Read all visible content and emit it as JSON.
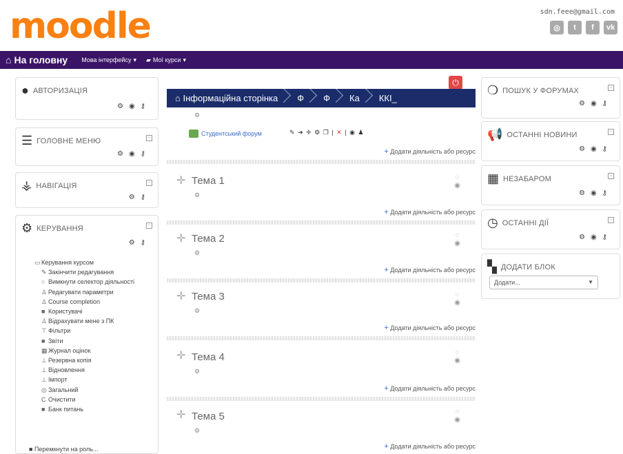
{
  "header": {
    "logo_text": "moodle",
    "user_email": "sdn.feee@gmail.com",
    "social_icons": [
      "globe-icon",
      "twitter-icon",
      "facebook-icon",
      "vk-icon"
    ]
  },
  "navbar": {
    "home_label": "На головну",
    "language_menu": "Мова інтерфейсу",
    "courses_menu": "Мої курси"
  },
  "left_blocks": {
    "auth": "АВТОРИЗАЦІЯ",
    "main_menu": "ГОЛОВНЕ МЕНЮ",
    "navigation": "НАВІГАЦІЯ",
    "management": "КЕРУВАННЯ"
  },
  "management_tree": {
    "root": "Керування курсом",
    "items": [
      {
        "icon": "pencil-icon",
        "label": "Закінчити редагування"
      },
      {
        "icon": "circle-icon",
        "label": "Вимкнути селектор діяльності"
      },
      {
        "icon": "user-icon",
        "label": "Редагувати параметри"
      },
      {
        "icon": "user-icon",
        "label": "Course completion"
      },
      {
        "icon": "folder-icon",
        "label": "Користувачі"
      },
      {
        "icon": "user-minus-icon",
        "label": "Відрахувати мене з ПК"
      },
      {
        "icon": "filter-icon",
        "label": "Фільтри"
      },
      {
        "icon": "folder-icon",
        "label": "Звіти"
      },
      {
        "icon": "table-icon",
        "label": "Журнал оцінок"
      },
      {
        "icon": "backup-icon",
        "label": "Резервна копія"
      },
      {
        "icon": "restore-icon",
        "label": "Відновлення"
      },
      {
        "icon": "import-icon",
        "label": "Імпорт"
      },
      {
        "icon": "share-icon",
        "label": "Загальний"
      },
      {
        "icon": "reset-icon",
        "label": "Очистити"
      },
      {
        "icon": "folder-icon",
        "label": "Банк питань"
      }
    ],
    "switch_role": "Перемкнути на роль..."
  },
  "breadcrumb": [
    "Інформаційна сторінка",
    "Ф",
    "Ф",
    "Ка",
    "ККІ_"
  ],
  "course": {
    "forum_label": "Студентський форум",
    "add_activity": "Додати діяльність або ресурс",
    "sections": [
      "Тема 1",
      "Тема 2",
      "Тема 3",
      "Тема 4",
      "Тема 5"
    ]
  },
  "right_blocks": {
    "forum_search": "ПОШУК У ФОРУМАХ",
    "latest_news": "ОСТАННІ НОВИНИ",
    "upcoming": "НЕЗАБАРОМ",
    "recent": "ОСТАННІ ДІЇ",
    "add_block": "ДОДАТИ БЛОК",
    "add_select_value": "Додати..."
  }
}
